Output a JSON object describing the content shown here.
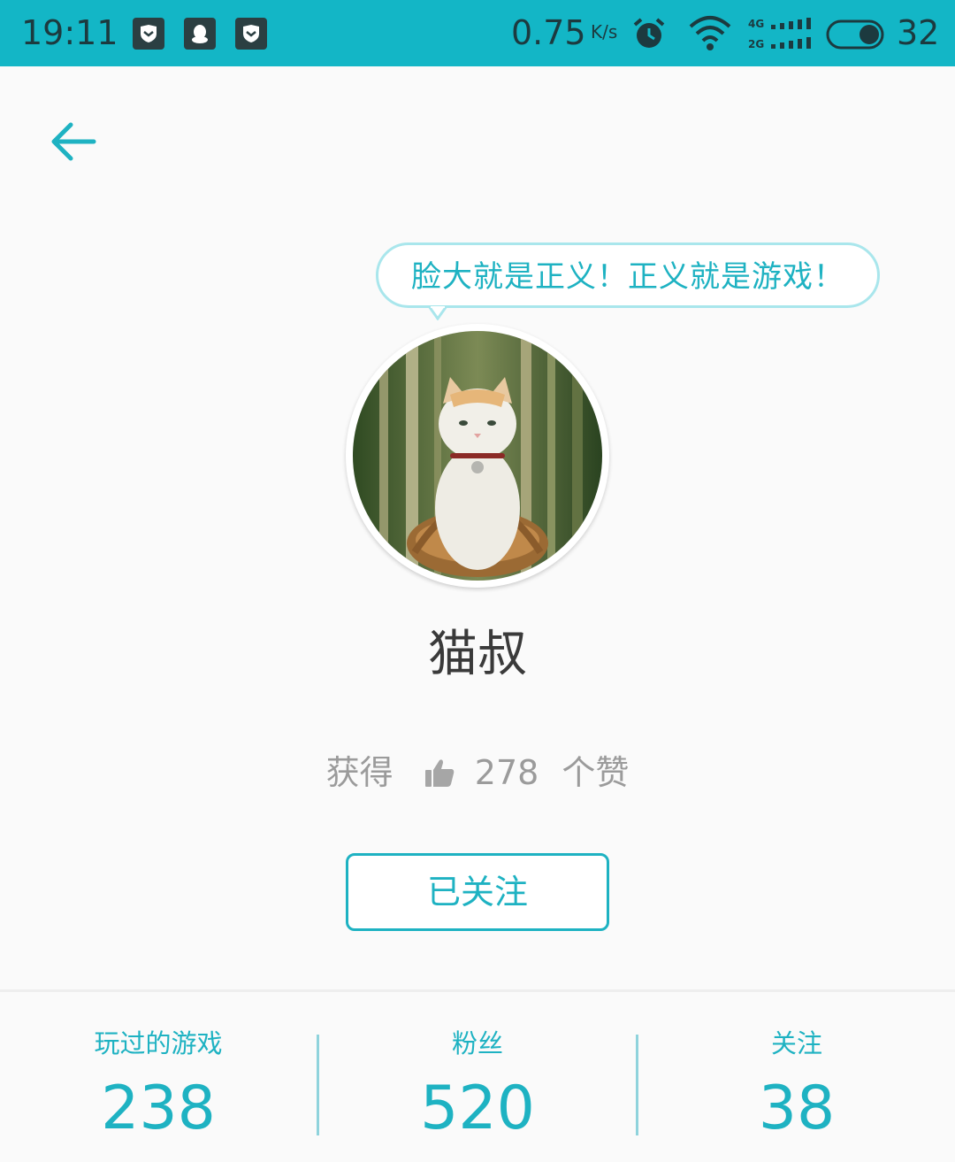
{
  "status_bar": {
    "time": "19:11",
    "network_speed": "0.75",
    "speed_unit": "K/s",
    "network_labels": [
      "4G",
      "2G"
    ],
    "battery": "32",
    "icons": [
      "shield-icon",
      "qq-icon",
      "shield-icon",
      "alarm-icon",
      "wifi-icon",
      "signal-icon",
      "battery-icon"
    ]
  },
  "header": {
    "back_icon": "arrow-left-icon"
  },
  "profile": {
    "bubble_text": "脸大就是正义！正义就是游戏！",
    "name": "猫叔",
    "likes_prefix": "获得",
    "likes_count": "278",
    "likes_suffix": "个赞",
    "follow_button_label": "已关注"
  },
  "stats": [
    {
      "label": "玩过的游戏",
      "value": "238"
    },
    {
      "label": "粉丝",
      "value": "520"
    },
    {
      "label": "关注",
      "value": "38"
    }
  ],
  "colors": {
    "accent": "#1eb2c2",
    "status_bar_bg": "#13b6c6",
    "background": "#fafafa",
    "muted_text": "#9b9b9b"
  }
}
